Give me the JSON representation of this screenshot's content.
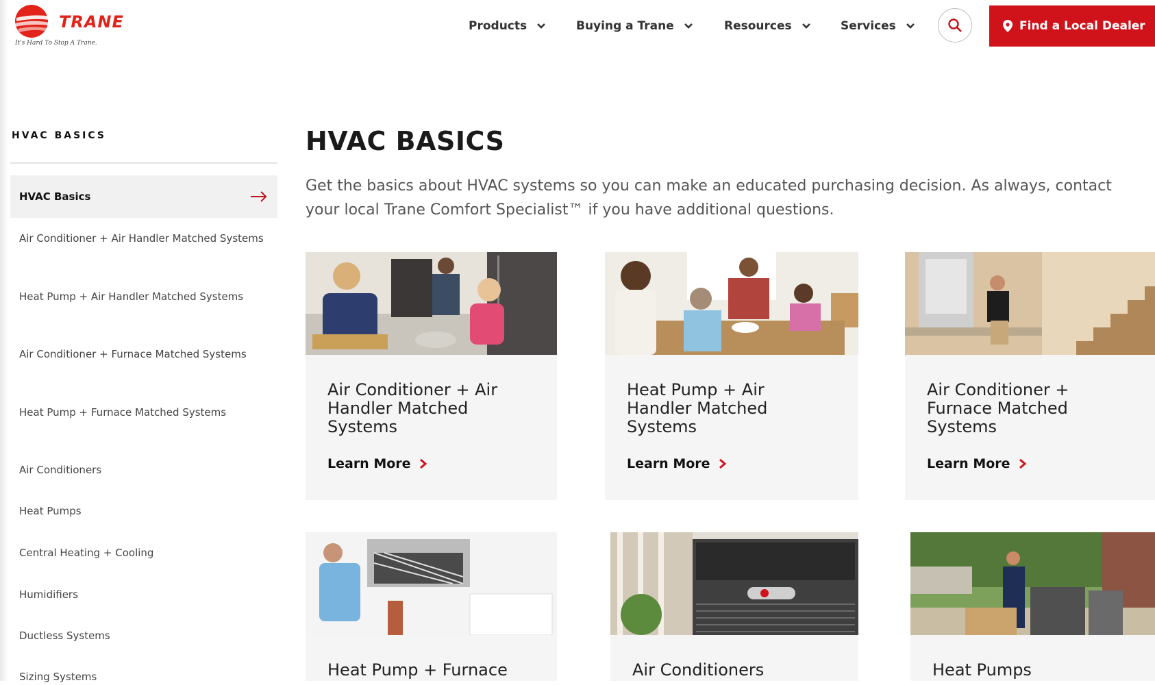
{
  "brand": {
    "name": "TRANE",
    "tagline": "It's Hard To Stop A Trane.",
    "accent": "#d0121a"
  },
  "nav": {
    "items": [
      {
        "label": "Products"
      },
      {
        "label": "Buying a Trane"
      },
      {
        "label": "Resources"
      },
      {
        "label": "Services"
      }
    ],
    "search_icon": "search-icon",
    "dealer_button": "Find a Local Dealer"
  },
  "sidebar": {
    "title": "HVAC BASICS",
    "active": "HVAC Basics",
    "items": [
      "Air Conditioner + Air Handler Matched Systems",
      "Heat Pump + Air Handler Matched Systems",
      "Air Conditioner + Furnace Matched Systems",
      "Heat Pump + Furnace Matched Systems",
      "Air Conditioners",
      "Heat Pumps",
      "Central Heating + Cooling",
      "Humidifiers",
      "Ductless Systems",
      "Sizing Systems"
    ]
  },
  "main": {
    "title": "HVAC BASICS",
    "intro": "Get the basics about HVAC systems so you can make an educated purchasing decision. As always, contact your local Trane Comfort Specialist™ if you have additional questions.",
    "learn_more": "Learn More",
    "cards": [
      {
        "title": "Air Conditioner + Air Handler Matched Systems"
      },
      {
        "title": "Heat Pump + Air Handler Matched Systems"
      },
      {
        "title": "Air Conditioner + Furnace Matched Systems"
      },
      {
        "title": "Heat Pump + Furnace"
      },
      {
        "title": "Air Conditioners"
      },
      {
        "title": "Heat Pumps"
      }
    ]
  }
}
